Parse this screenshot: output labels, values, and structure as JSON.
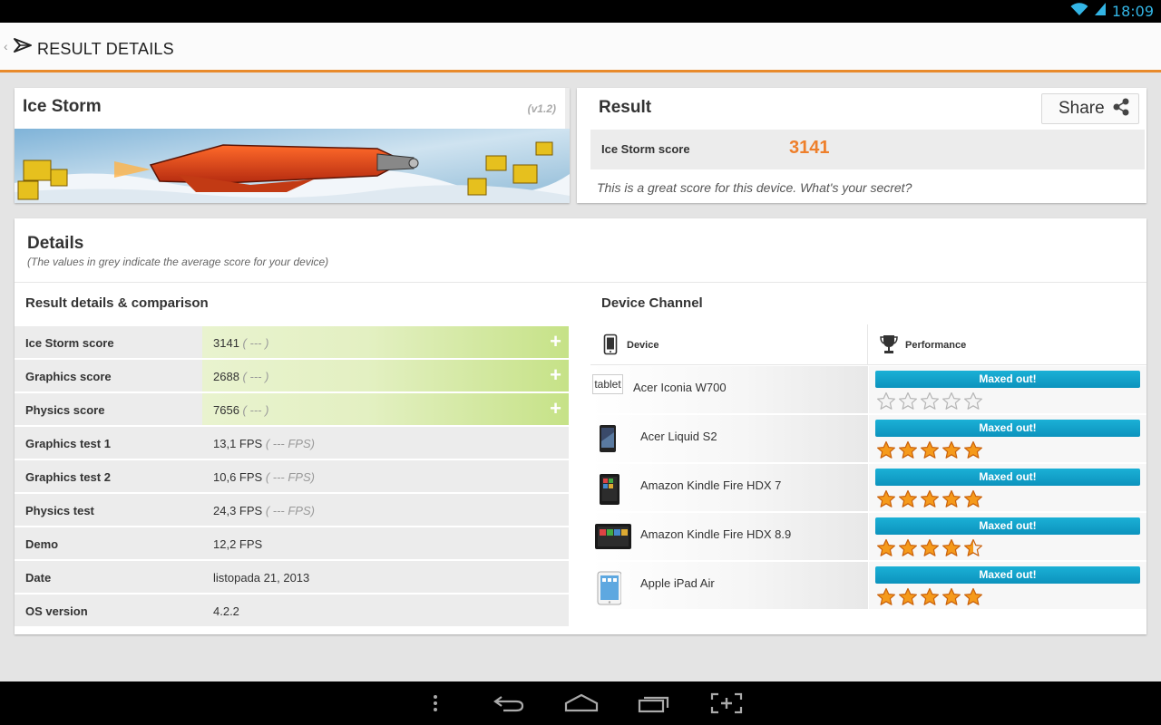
{
  "status_bar": {
    "time": "18:09"
  },
  "action_bar": {
    "title": "RESULT DETAILS"
  },
  "test_card": {
    "name": "Ice Storm",
    "version": "(v1.2)"
  },
  "result_card": {
    "heading": "Result",
    "share_label": "Share",
    "score_label": "Ice Storm score",
    "score_value": "3141",
    "message": "This is a great score for this device. What's your secret?"
  },
  "details": {
    "heading": "Details",
    "subtitle": "(The values in grey indicate the average score for your device)",
    "left_section_title": "Result details & comparison",
    "right_section_title": "Device Channel",
    "rows": [
      {
        "label": "Ice Storm score",
        "value": "3141",
        "avg": "( --- )",
        "highlight": true
      },
      {
        "label": "Graphics score",
        "value": "2688",
        "avg": "( --- )",
        "highlight": true
      },
      {
        "label": "Physics score",
        "value": "7656",
        "avg": "( --- )",
        "highlight": true
      },
      {
        "label": "Graphics test 1",
        "value": "13,1 FPS",
        "avg": "( --- FPS)"
      },
      {
        "label": "Graphics test 2",
        "value": "10,6 FPS",
        "avg": "( --- FPS)"
      },
      {
        "label": "Physics test",
        "value": "24,3 FPS",
        "avg": "( --- FPS)"
      },
      {
        "label": "Demo",
        "value": "12,2 FPS",
        "avg": ""
      },
      {
        "label": "Date",
        "value": "listopada 21, 2013",
        "avg": ""
      },
      {
        "label": "OS version",
        "value": "4.2.2",
        "avg": ""
      }
    ],
    "device_channel": {
      "device_header": "Device",
      "performance_header": "Performance",
      "devices": [
        {
          "name": "Acer Iconia W700",
          "thumb_text": "tablet",
          "performance": "Maxed out!",
          "stars": 0
        },
        {
          "name": "Acer Liquid S2",
          "performance": "Maxed out!",
          "stars": 5
        },
        {
          "name": "Amazon Kindle Fire HDX 7",
          "performance": "Maxed out!",
          "stars": 5
        },
        {
          "name": "Amazon Kindle Fire HDX 8.9",
          "performance": "Maxed out!",
          "stars": 4.5
        },
        {
          "name": "Apple iPad Air",
          "performance": "Maxed out!",
          "stars": 5
        }
      ]
    }
  },
  "colors": {
    "accent": "#ee7f2b",
    "bar": "#1bb0d6",
    "highlight": "#c6e287",
    "time": "#33b5e5"
  },
  "icons": [
    "wifi-icon",
    "signal-icon",
    "app-logo-icon",
    "share-icon",
    "phone-icon",
    "trophy-icon",
    "star-icon",
    "menu-icon",
    "back-icon",
    "home-icon",
    "recent-apps-icon",
    "screenshot-icon"
  ]
}
